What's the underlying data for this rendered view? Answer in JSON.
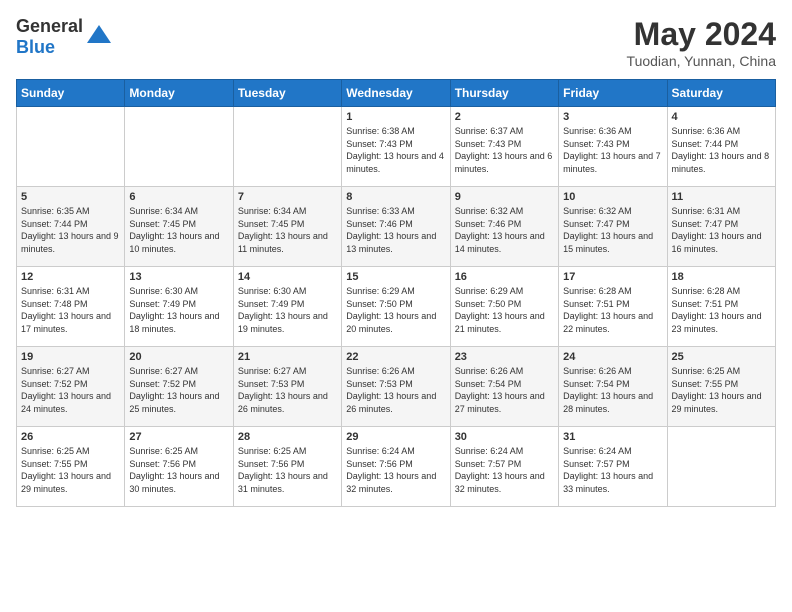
{
  "header": {
    "logo_general": "General",
    "logo_blue": "Blue",
    "month_year": "May 2024",
    "location": "Tuodian, Yunnan, China"
  },
  "weekdays": [
    "Sunday",
    "Monday",
    "Tuesday",
    "Wednesday",
    "Thursday",
    "Friday",
    "Saturday"
  ],
  "weeks": [
    [
      {
        "day": "",
        "sunrise": "",
        "sunset": "",
        "daylight": ""
      },
      {
        "day": "",
        "sunrise": "",
        "sunset": "",
        "daylight": ""
      },
      {
        "day": "",
        "sunrise": "",
        "sunset": "",
        "daylight": ""
      },
      {
        "day": "1",
        "sunrise": "Sunrise: 6:38 AM",
        "sunset": "Sunset: 7:43 PM",
        "daylight": "Daylight: 13 hours and 4 minutes."
      },
      {
        "day": "2",
        "sunrise": "Sunrise: 6:37 AM",
        "sunset": "Sunset: 7:43 PM",
        "daylight": "Daylight: 13 hours and 6 minutes."
      },
      {
        "day": "3",
        "sunrise": "Sunrise: 6:36 AM",
        "sunset": "Sunset: 7:43 PM",
        "daylight": "Daylight: 13 hours and 7 minutes."
      },
      {
        "day": "4",
        "sunrise": "Sunrise: 6:36 AM",
        "sunset": "Sunset: 7:44 PM",
        "daylight": "Daylight: 13 hours and 8 minutes."
      }
    ],
    [
      {
        "day": "5",
        "sunrise": "Sunrise: 6:35 AM",
        "sunset": "Sunset: 7:44 PM",
        "daylight": "Daylight: 13 hours and 9 minutes."
      },
      {
        "day": "6",
        "sunrise": "Sunrise: 6:34 AM",
        "sunset": "Sunset: 7:45 PM",
        "daylight": "Daylight: 13 hours and 10 minutes."
      },
      {
        "day": "7",
        "sunrise": "Sunrise: 6:34 AM",
        "sunset": "Sunset: 7:45 PM",
        "daylight": "Daylight: 13 hours and 11 minutes."
      },
      {
        "day": "8",
        "sunrise": "Sunrise: 6:33 AM",
        "sunset": "Sunset: 7:46 PM",
        "daylight": "Daylight: 13 hours and 13 minutes."
      },
      {
        "day": "9",
        "sunrise": "Sunrise: 6:32 AM",
        "sunset": "Sunset: 7:46 PM",
        "daylight": "Daylight: 13 hours and 14 minutes."
      },
      {
        "day": "10",
        "sunrise": "Sunrise: 6:32 AM",
        "sunset": "Sunset: 7:47 PM",
        "daylight": "Daylight: 13 hours and 15 minutes."
      },
      {
        "day": "11",
        "sunrise": "Sunrise: 6:31 AM",
        "sunset": "Sunset: 7:47 PM",
        "daylight": "Daylight: 13 hours and 16 minutes."
      }
    ],
    [
      {
        "day": "12",
        "sunrise": "Sunrise: 6:31 AM",
        "sunset": "Sunset: 7:48 PM",
        "daylight": "Daylight: 13 hours and 17 minutes."
      },
      {
        "day": "13",
        "sunrise": "Sunrise: 6:30 AM",
        "sunset": "Sunset: 7:49 PM",
        "daylight": "Daylight: 13 hours and 18 minutes."
      },
      {
        "day": "14",
        "sunrise": "Sunrise: 6:30 AM",
        "sunset": "Sunset: 7:49 PM",
        "daylight": "Daylight: 13 hours and 19 minutes."
      },
      {
        "day": "15",
        "sunrise": "Sunrise: 6:29 AM",
        "sunset": "Sunset: 7:50 PM",
        "daylight": "Daylight: 13 hours and 20 minutes."
      },
      {
        "day": "16",
        "sunrise": "Sunrise: 6:29 AM",
        "sunset": "Sunset: 7:50 PM",
        "daylight": "Daylight: 13 hours and 21 minutes."
      },
      {
        "day": "17",
        "sunrise": "Sunrise: 6:28 AM",
        "sunset": "Sunset: 7:51 PM",
        "daylight": "Daylight: 13 hours and 22 minutes."
      },
      {
        "day": "18",
        "sunrise": "Sunrise: 6:28 AM",
        "sunset": "Sunset: 7:51 PM",
        "daylight": "Daylight: 13 hours and 23 minutes."
      }
    ],
    [
      {
        "day": "19",
        "sunrise": "Sunrise: 6:27 AM",
        "sunset": "Sunset: 7:52 PM",
        "daylight": "Daylight: 13 hours and 24 minutes."
      },
      {
        "day": "20",
        "sunrise": "Sunrise: 6:27 AM",
        "sunset": "Sunset: 7:52 PM",
        "daylight": "Daylight: 13 hours and 25 minutes."
      },
      {
        "day": "21",
        "sunrise": "Sunrise: 6:27 AM",
        "sunset": "Sunset: 7:53 PM",
        "daylight": "Daylight: 13 hours and 26 minutes."
      },
      {
        "day": "22",
        "sunrise": "Sunrise: 6:26 AM",
        "sunset": "Sunset: 7:53 PM",
        "daylight": "Daylight: 13 hours and 26 minutes."
      },
      {
        "day": "23",
        "sunrise": "Sunrise: 6:26 AM",
        "sunset": "Sunset: 7:54 PM",
        "daylight": "Daylight: 13 hours and 27 minutes."
      },
      {
        "day": "24",
        "sunrise": "Sunrise: 6:26 AM",
        "sunset": "Sunset: 7:54 PM",
        "daylight": "Daylight: 13 hours and 28 minutes."
      },
      {
        "day": "25",
        "sunrise": "Sunrise: 6:25 AM",
        "sunset": "Sunset: 7:55 PM",
        "daylight": "Daylight: 13 hours and 29 minutes."
      }
    ],
    [
      {
        "day": "26",
        "sunrise": "Sunrise: 6:25 AM",
        "sunset": "Sunset: 7:55 PM",
        "daylight": "Daylight: 13 hours and 29 minutes."
      },
      {
        "day": "27",
        "sunrise": "Sunrise: 6:25 AM",
        "sunset": "Sunset: 7:56 PM",
        "daylight": "Daylight: 13 hours and 30 minutes."
      },
      {
        "day": "28",
        "sunrise": "Sunrise: 6:25 AM",
        "sunset": "Sunset: 7:56 PM",
        "daylight": "Daylight: 13 hours and 31 minutes."
      },
      {
        "day": "29",
        "sunrise": "Sunrise: 6:24 AM",
        "sunset": "Sunset: 7:56 PM",
        "daylight": "Daylight: 13 hours and 32 minutes."
      },
      {
        "day": "30",
        "sunrise": "Sunrise: 6:24 AM",
        "sunset": "Sunset: 7:57 PM",
        "daylight": "Daylight: 13 hours and 32 minutes."
      },
      {
        "day": "31",
        "sunrise": "Sunrise: 6:24 AM",
        "sunset": "Sunset: 7:57 PM",
        "daylight": "Daylight: 13 hours and 33 minutes."
      },
      {
        "day": "",
        "sunrise": "",
        "sunset": "",
        "daylight": ""
      }
    ]
  ]
}
